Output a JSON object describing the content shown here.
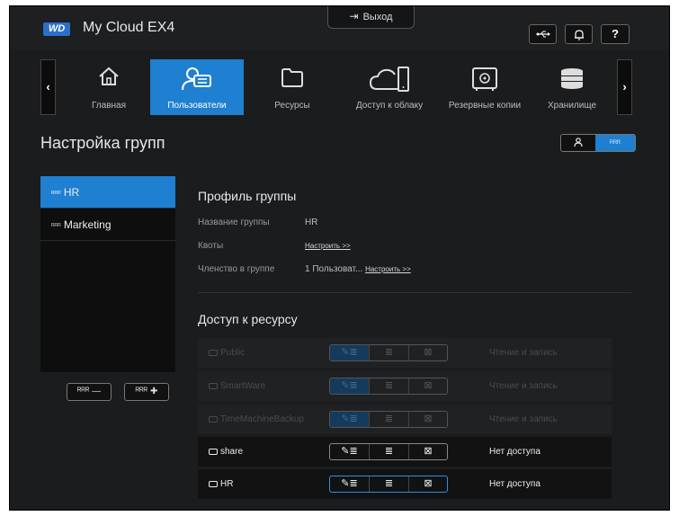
{
  "app": {
    "logo": "WD",
    "title": "My Cloud EX4"
  },
  "header": {
    "logout_label": "Выход",
    "help_label": "?"
  },
  "nav": {
    "items": [
      {
        "label": "Главная",
        "icon": "home-icon"
      },
      {
        "label": "Пользователи",
        "icon": "users-icon",
        "active": true
      },
      {
        "label": "Ресурсы",
        "icon": "folder-icon"
      },
      {
        "label": "Доступ к облаку",
        "icon": "cloud-device-icon"
      },
      {
        "label": "Резервные копии",
        "icon": "safe-icon"
      },
      {
        "label": "Хранилище",
        "icon": "storage-icon"
      }
    ]
  },
  "page": {
    "title": "Настройка групп"
  },
  "groups": [
    {
      "name": "HR",
      "selected": true
    },
    {
      "name": "Marketing"
    }
  ],
  "profile": {
    "title": "Профиль группы",
    "name_label": "Название группы",
    "name_value": "HR",
    "quota_label": "Квоты",
    "quota_link": "Настроить >>",
    "membership_label": "Членство в группе",
    "membership_value": "1 Пользоват...",
    "membership_link": "Настроить >>"
  },
  "access": {
    "title": "Доступ к ресурсу",
    "shares": [
      {
        "name": "Public",
        "status": "Чтение и запись",
        "enabled": false
      },
      {
        "name": "SmartWare",
        "status": "Чтение и запись",
        "enabled": false
      },
      {
        "name": "TimeMachineBackup",
        "status": "Чтение и запись",
        "enabled": false
      },
      {
        "name": "share",
        "status": "Нет доступа",
        "enabled": true
      },
      {
        "name": "HR",
        "status": "Нет доступа",
        "enabled": true
      }
    ]
  },
  "colors": {
    "accent": "#1f7fd1",
    "background": "#1b1c1e"
  }
}
